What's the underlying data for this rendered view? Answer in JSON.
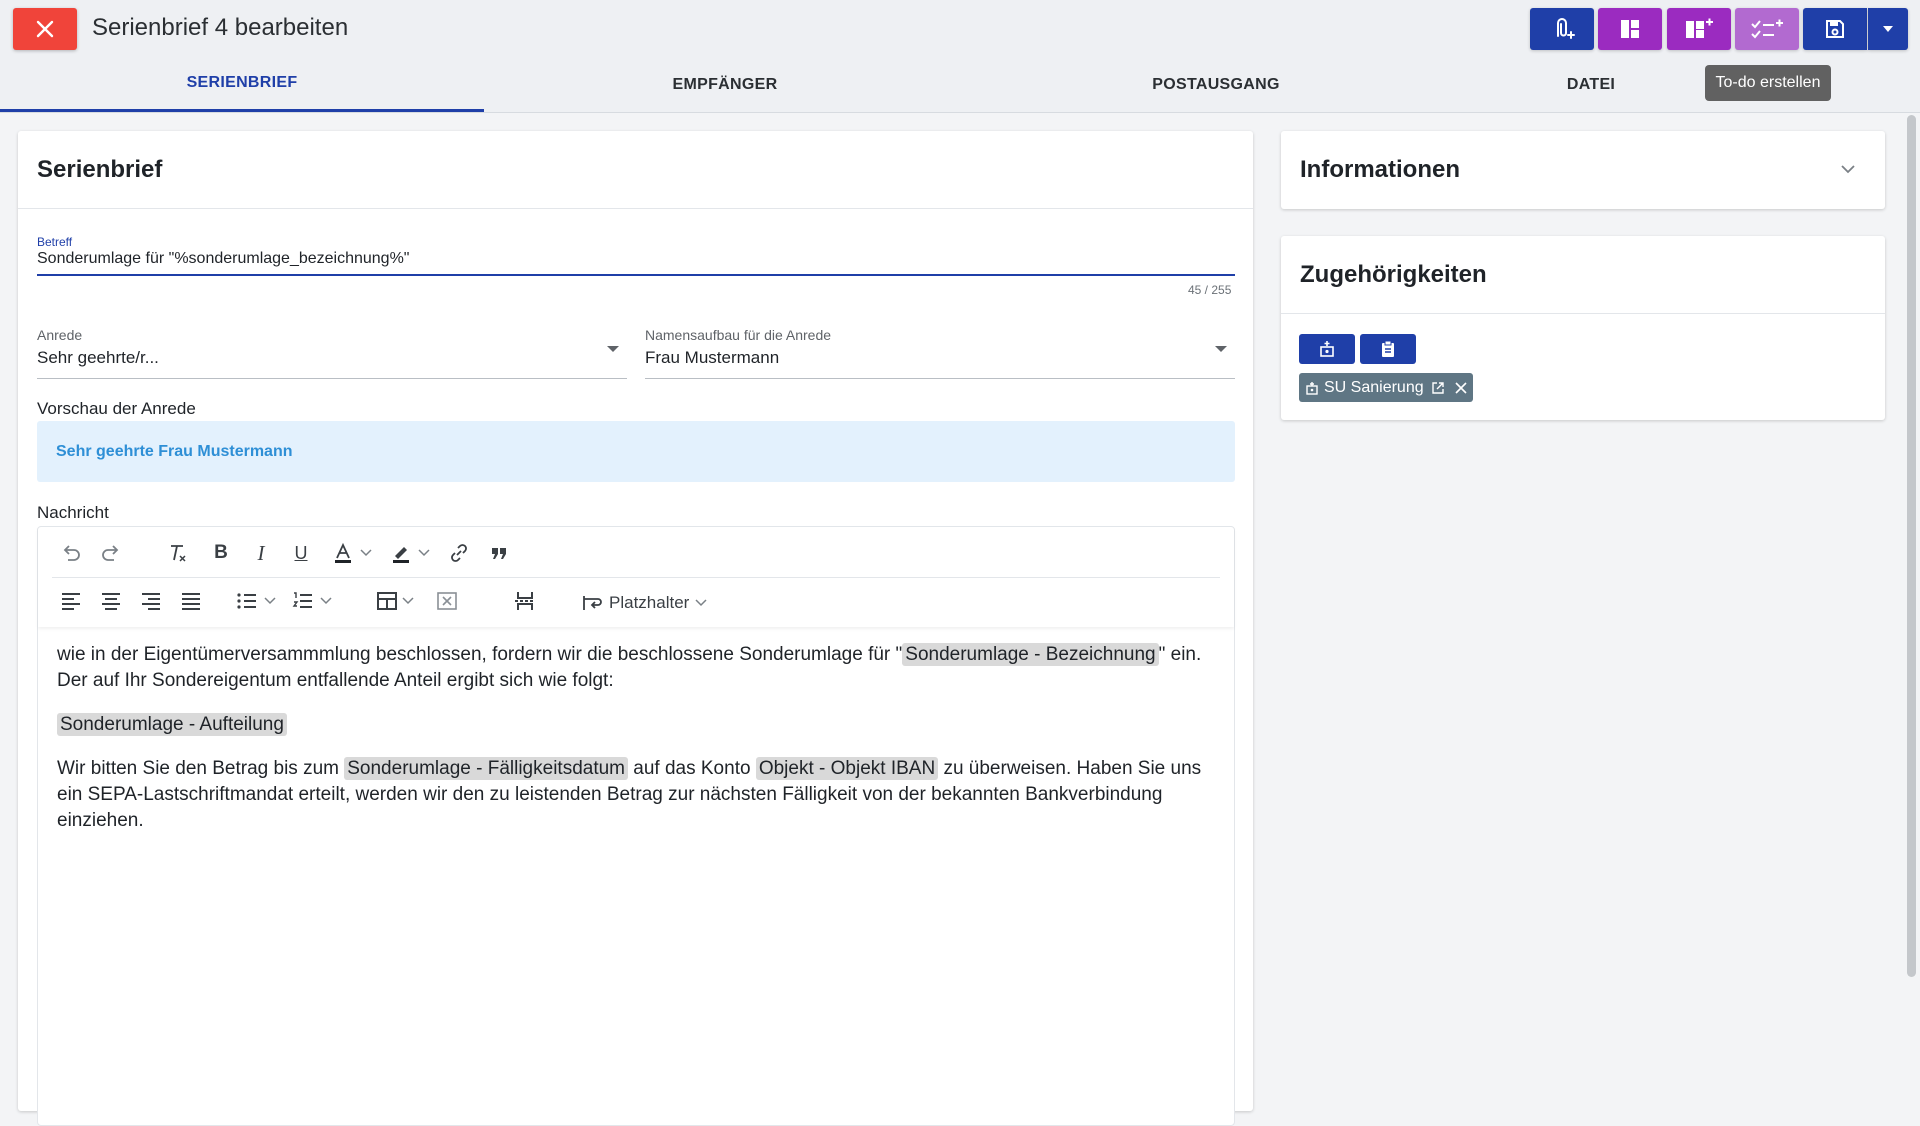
{
  "header": {
    "title": "Serienbrief 4 bearbeiten",
    "tooltip": "To-do erstellen"
  },
  "tabs": [
    {
      "label": "SERIENBRIEF",
      "active": true
    },
    {
      "label": "EMPFÄNGER",
      "active": false
    },
    {
      "label": "POSTAUSGANG",
      "active": false
    },
    {
      "label": "DATEI",
      "active": false
    }
  ],
  "main": {
    "card_title": "Serienbrief",
    "betreff": {
      "label": "Betreff",
      "value": "Sonderumlage für \"%sonderumlage_bezeichnung%\"",
      "counter": "45 / 255"
    },
    "anrede": {
      "label": "Anrede",
      "value": "Sehr geehrte/r..."
    },
    "namensaufbau": {
      "label": "Namensaufbau für die Anrede",
      "value": "Frau Mustermann"
    },
    "preview": {
      "label": "Vorschau der Anrede",
      "value": "Sehr geehrte Frau Mustermann"
    },
    "nachricht": {
      "label": "Nachricht",
      "placeholder_menu": "Platzhalter",
      "p1_a": "wie in der Eigentümerversammmlung beschlossen, fordern wir die beschlossene Sonderumlage für \"",
      "p1_chip": "Sonderumlage - Bezeichnung",
      "p1_b": "\" ein. Der auf Ihr Sondereigentum entfallende Anteil ergibt sich wie folgt:",
      "p2_chip": "Sonderumlage - Aufteilung",
      "p3_a": "Wir bitten Sie den Betrag bis zum ",
      "p3_chip1": "Sonderumlage - Fälligkeitsdatum",
      "p3_b": " auf das Konto ",
      "p3_chip2": "Objekt - Objekt IBAN",
      "p3_c": " zu überweisen. Haben Sie uns ein SEPA-Lastschriftmandat erteilt, werden wir den zu leistenden Betrag zur nächsten Fälligkeit von der bekannten Bankverbindung einziehen."
    }
  },
  "sidebar": {
    "info_title": "Informationen",
    "zugehoerigkeiten_title": "Zugehörigkeiten",
    "tag_label": "SU Sanierung"
  },
  "colors": {
    "primary": "#1f3fa8",
    "purple": "#9b2bc0",
    "purple_light": "#b26ad0",
    "danger": "#f0443a",
    "preview_bg": "#e3f1fd",
    "preview_text": "#2e8fd6",
    "tag_bg": "#5f7684"
  }
}
